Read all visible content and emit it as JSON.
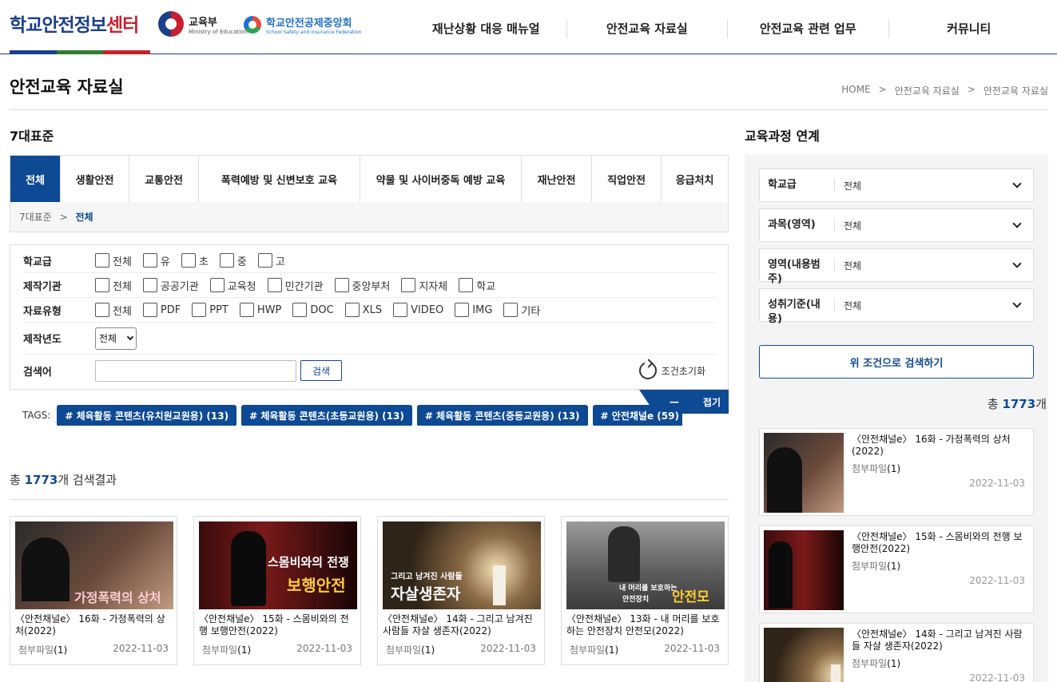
{
  "header": {
    "logo_part1": "학교안전",
    "logo_part2": "정보",
    "logo_part3": "센터",
    "moe_name": "교육부",
    "moe_en": "Ministry of Education",
    "ssif_name": "학교안전공제중앙회",
    "ssif_en": "School Safety and Insurance Federation",
    "nav": [
      "재난상황 대응 매뉴얼",
      "안전교육 자료실",
      "안전교육 관련 업무",
      "커뮤니티"
    ]
  },
  "page": {
    "title": "안전교육 자료실",
    "breadcrumb": [
      "HOME",
      ">",
      "안전교육 자료실",
      ">",
      "안전교육 자료실"
    ]
  },
  "standards": {
    "title": "7대표준",
    "tabs": [
      "전체",
      "생활안전",
      "교통안전",
      "폭력예방 및 신변보호 교육",
      "약물 및 사이버중독 예방 교육",
      "재난안전",
      "직업안전",
      "응급처치"
    ],
    "active_tab": "전체",
    "crumb_root": "7대표준",
    "crumb_sep": ">",
    "crumb_current": "전체"
  },
  "filter": {
    "school_label": "학교급",
    "school_options": [
      "전체",
      "유",
      "초",
      "중",
      "고"
    ],
    "org_label": "제작기관",
    "org_options": [
      "전체",
      "공공기관",
      "교육청",
      "민간기관",
      "중앙부처",
      "지자체",
      "학교"
    ],
    "type_label": "자료유형",
    "type_options": [
      "전체",
      "PDF",
      "PPT",
      "HWP",
      "DOC",
      "XLS",
      "VIDEO",
      "IMG",
      "기타"
    ],
    "year_label": "제작년도",
    "year_value": "전체",
    "keyword_label": "검색어",
    "keyword_value": "",
    "search_button": "검색",
    "reset_label": "조건초기화",
    "fold_minus": "—",
    "fold_label": "접기"
  },
  "tags": {
    "label": "TAGS:",
    "items": [
      "# 체육활동 콘텐츠(유치원교원용) (13)",
      "# 체육활동 콘텐츠(초등교원용) (13)",
      "# 체육활동 콘텐츠(중등교원용) (13)",
      "# 안전채널e (59)"
    ]
  },
  "results": {
    "prefix": "총 ",
    "count": "1773",
    "suffix": "개 검색결과",
    "cards": [
      {
        "title": "〈안전채널e〉 16화 - 가정폭력의 상처(2022)",
        "attach_label": "첨부파일",
        "attach_count": "(1)",
        "date": "2022-11-03",
        "thumb_text": "가정폭력의 상처"
      },
      {
        "title": "〈안전채널e〉 15화 - 스몸비와의 전행 보행안전(2022)",
        "attach_label": "첨부파일",
        "attach_count": "(1)",
        "date": "2022-11-03",
        "thumb_text": "스몸비와의 전쟁",
        "thumb_text2": "보행안전"
      },
      {
        "title": "〈안전채널e〉 14화 - 그리고 남겨진 사람들 자살 생존자(2022)",
        "attach_label": "첨부파일",
        "attach_count": "(1)",
        "date": "2022-11-03",
        "thumb_text": "그리고 남겨진 사람들",
        "thumb_text2": "자살생존자"
      },
      {
        "title": "〈안전채널e〉 13화 - 내 머리를 보호하는 안전장치 안전모(2022)",
        "attach_label": "첨부파일",
        "attach_count": "(1)",
        "date": "2022-11-03",
        "thumb_text": "내 머리를 보호하는",
        "thumb_text2": "안전장치",
        "thumb_text3": "안전모"
      }
    ]
  },
  "curriculum": {
    "title": "교육과정 연계",
    "selects": [
      {
        "label": "학교급",
        "value": "전체"
      },
      {
        "label": "과목(영역)",
        "value": "전체"
      },
      {
        "label": "영역(내용범주)",
        "value": "전체"
      },
      {
        "label": "성취기준(내용)",
        "value": "전체"
      }
    ],
    "search_button": "위 조건으로 검색하기",
    "count_prefix": "총 ",
    "count": "1773",
    "count_suffix": "개",
    "items": [
      {
        "title": "〈안전채널e〉 16화 - 가정폭력의 상처(2022)",
        "attach_label": "첨부파일",
        "attach_count": "(1)",
        "date": "2022-11-03"
      },
      {
        "title": "〈안전채널e〉 15화 - 스몸비와의 전행 보행안전(2022)",
        "attach_label": "첨부파일",
        "attach_count": "(1)",
        "date": "2022-11-03"
      },
      {
        "title": "〈안전채널e〉 14화 - 그리고 남겨진 사람들 자살 생존자(2022)",
        "attach_label": "첨부파일",
        "attach_count": "(1)",
        "date": "2022-11-03"
      }
    ]
  },
  "colors": {
    "primary": "#0e4a94",
    "logo_blue": "#1b3f8b",
    "logo_red": "#c8202e",
    "logo_bar": [
      "#1b3f8b",
      "#2e7d32",
      "#c8202e"
    ]
  }
}
